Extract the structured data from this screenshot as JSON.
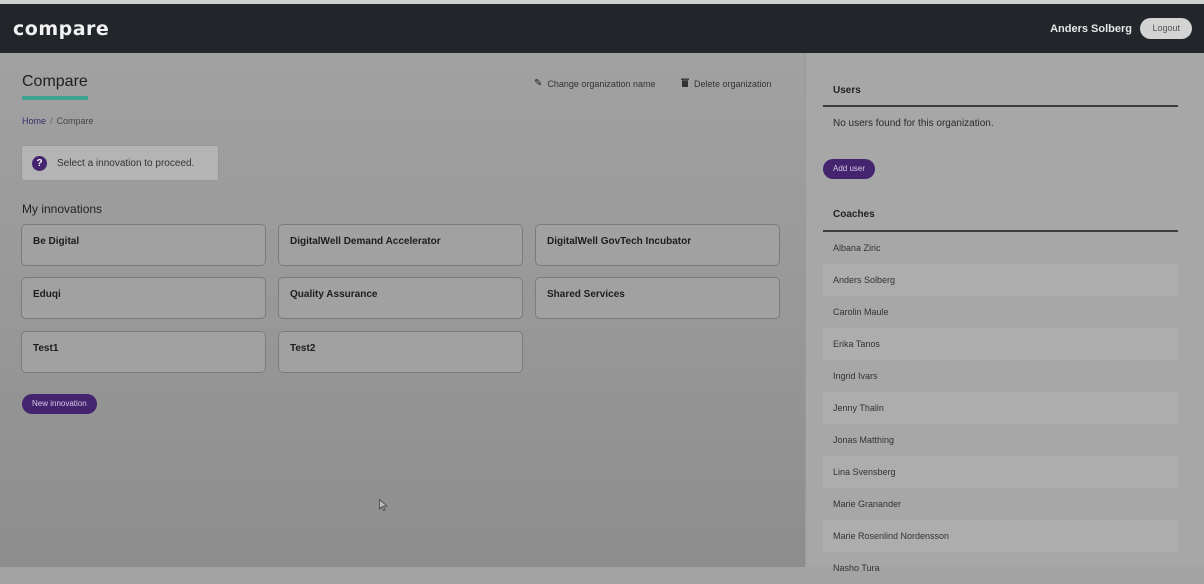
{
  "navbar": {
    "logo": "compare",
    "user_name": "Anders Solberg",
    "logout_label": "Logout"
  },
  "page": {
    "title": "Compare",
    "actions": [
      {
        "icon": "pencil-icon",
        "label": "Change organization name"
      },
      {
        "icon": "trash-icon",
        "label": "Delete organization"
      }
    ],
    "breadcrumb": {
      "home": "Home",
      "separator": "/",
      "current": "Compare"
    }
  },
  "alert": {
    "icon": "question-icon",
    "message": "Select a innovation to proceed."
  },
  "innovations": {
    "title": "My innovations",
    "items": [
      "Be Digital",
      "DigitalWell Demand Accelerator",
      "DigitalWell GovTech Incubator",
      "Eduqi",
      "Quality Assurance",
      "Shared Services",
      "Test1",
      "Test2"
    ],
    "new_button": "New innovation"
  },
  "sidebar": {
    "users": {
      "title": "Users",
      "empty_message": "No users found for this organization.",
      "add_button": "Add user"
    },
    "coaches": {
      "title": "Coaches",
      "items": [
        "Albana Ziric",
        "Anders Solberg",
        "Carolin Maule",
        "Erika Tanos",
        "Ingrid Ivars",
        "Jenny Thalin",
        "Jonas Matthing",
        "Lina Svensberg",
        "Marie Granander",
        "Marie Rosenlind Nordensson",
        "Nasho Tura"
      ]
    }
  },
  "colors": {
    "navbar": "#22252a",
    "accent_purple": "#44246e",
    "title_underline": "#3fa290"
  }
}
